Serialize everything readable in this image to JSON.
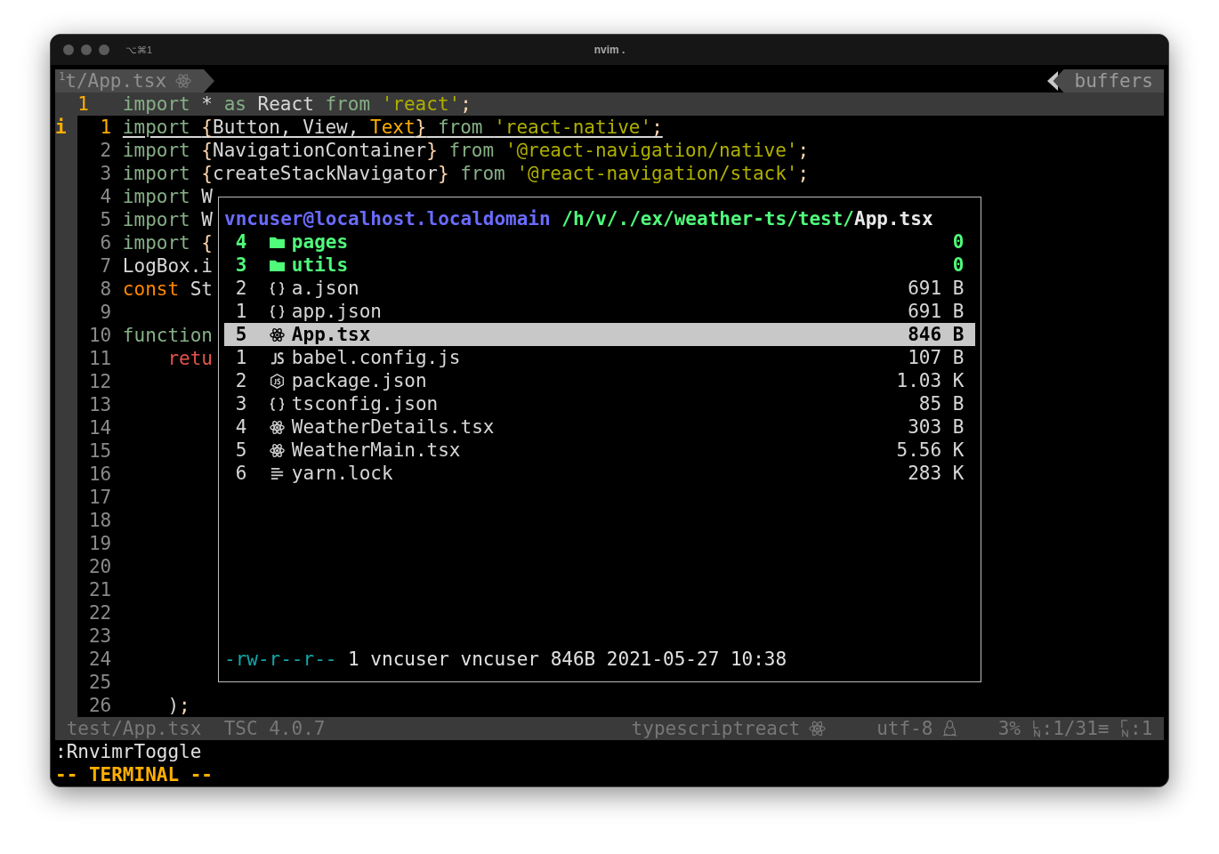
{
  "window": {
    "shortcut": "⌥⌘1",
    "title": "nvim ."
  },
  "tabline": {
    "tab": {
      "number": "1",
      "label": "t/App.tsx"
    },
    "buffers_label": "buffers"
  },
  "context_line": {
    "number": "1",
    "tokens": [
      {
        "kind": "kw",
        "text": "import"
      },
      {
        "kind": "id",
        "text": " * "
      },
      {
        "kind": "kw",
        "text": "as"
      },
      {
        "kind": "id",
        "text": " React "
      },
      {
        "kind": "kw",
        "text": "from "
      },
      {
        "kind": "str",
        "text": "'react'"
      },
      {
        "kind": "punct",
        "text": ";"
      }
    ]
  },
  "lines": [
    {
      "number": "1",
      "current": true,
      "sign": "i",
      "tokens": [
        {
          "kind": "kw",
          "text": "import "
        },
        {
          "kind": "punct",
          "text": "{"
        },
        {
          "kind": "id",
          "text": "Button, View, "
        },
        {
          "kind": "type",
          "text": "Text"
        },
        {
          "kind": "punct",
          "text": "}"
        },
        {
          "kind": "kw",
          "text": " from "
        },
        {
          "kind": "str",
          "text": "'react-native'"
        },
        {
          "kind": "punct",
          "text": ";"
        }
      ]
    },
    {
      "number": "2",
      "current": false,
      "tokens": [
        {
          "kind": "kw",
          "text": "import "
        },
        {
          "kind": "punct",
          "text": "{"
        },
        {
          "kind": "id",
          "text": "NavigationContainer"
        },
        {
          "kind": "punct",
          "text": "}"
        },
        {
          "kind": "kw",
          "text": " from "
        },
        {
          "kind": "str",
          "text": "'@react-navigation/native'"
        },
        {
          "kind": "punct",
          "text": ";"
        }
      ]
    },
    {
      "number": "3",
      "current": false,
      "tokens": [
        {
          "kind": "kw",
          "text": "import "
        },
        {
          "kind": "punct",
          "text": "{"
        },
        {
          "kind": "id",
          "text": "createStackNavigator"
        },
        {
          "kind": "punct",
          "text": "}"
        },
        {
          "kind": "kw",
          "text": " from "
        },
        {
          "kind": "str",
          "text": "'@react-navigation/stack'"
        },
        {
          "kind": "punct",
          "text": ";"
        }
      ]
    },
    {
      "number": "4",
      "current": false,
      "tokens": [
        {
          "kind": "kw",
          "text": "import"
        },
        {
          "kind": "id",
          "text": " W"
        }
      ]
    },
    {
      "number": "5",
      "current": false,
      "tokens": [
        {
          "kind": "kw",
          "text": "import"
        },
        {
          "kind": "id",
          "text": " W"
        }
      ]
    },
    {
      "number": "6",
      "current": false,
      "tokens": [
        {
          "kind": "kw",
          "text": "import "
        },
        {
          "kind": "punct",
          "text": "{"
        }
      ]
    },
    {
      "number": "7",
      "current": false,
      "tokens": [
        {
          "kind": "id",
          "text": "LogBox.i"
        }
      ]
    },
    {
      "number": "8",
      "current": false,
      "tokens": [
        {
          "kind": "decl",
          "text": "const"
        },
        {
          "kind": "id",
          "text": " St"
        }
      ]
    },
    {
      "number": "9",
      "current": false
    },
    {
      "number": "10",
      "current": false,
      "tokens": [
        {
          "kind": "kw",
          "text": "function"
        }
      ]
    },
    {
      "number": "11",
      "current": false,
      "indented": true,
      "tokens": [
        {
          "kind": "ret",
          "text": "retu"
        }
      ]
    },
    {
      "number": "12",
      "current": false
    },
    {
      "number": "13",
      "current": false
    },
    {
      "number": "14",
      "current": false
    },
    {
      "number": "15",
      "current": false
    },
    {
      "number": "16",
      "current": false
    },
    {
      "number": "17",
      "current": false
    },
    {
      "number": "18",
      "current": false
    },
    {
      "number": "19",
      "current": false
    },
    {
      "number": "20",
      "current": false
    },
    {
      "number": "21",
      "current": false
    },
    {
      "number": "22",
      "current": false
    },
    {
      "number": "23",
      "current": false
    },
    {
      "number": "24",
      "current": false
    },
    {
      "number": "25",
      "current": false
    },
    {
      "number": "26",
      "current": false,
      "indented": true,
      "tokens": [
        {
          "kind": "id",
          "text": ")"
        },
        {
          "kind": "punct",
          "text": ";"
        }
      ]
    }
  ],
  "file_manager": {
    "host": "vncuser@localhost.localdomain",
    "path": "/h/v/./ex/weather-ts/test/",
    "file": "App.tsx",
    "entries": [
      {
        "count": "4",
        "kind": "folder",
        "name": "pages",
        "size": "0",
        "selected": false
      },
      {
        "count": "3",
        "kind": "folder",
        "name": "utils",
        "size": "0",
        "selected": false
      },
      {
        "count": "2",
        "kind": "json",
        "name": "a.json",
        "size": "691 B",
        "selected": false
      },
      {
        "count": "1",
        "kind": "json",
        "name": "app.json",
        "size": "691 B",
        "selected": false
      },
      {
        "count": "5",
        "kind": "react",
        "name": "App.tsx",
        "size": "846 B",
        "selected": true
      },
      {
        "count": "1",
        "kind": "script",
        "name": "babel.config.js",
        "size": "107 B",
        "selected": false
      },
      {
        "count": "2",
        "kind": "package",
        "name": "package.json",
        "size": "1.03 K",
        "selected": false
      },
      {
        "count": "3",
        "kind": "json",
        "name": "tsconfig.json",
        "size": "85 B",
        "selected": false
      },
      {
        "count": "4",
        "kind": "react",
        "name": "WeatherDetails.tsx",
        "size": "303 B",
        "selected": false
      },
      {
        "count": "5",
        "kind": "react",
        "name": "WeatherMain.tsx",
        "size": "5.56 K",
        "selected": false
      },
      {
        "count": "6",
        "kind": "text",
        "name": "yarn.lock",
        "size": "283 K",
        "selected": false
      }
    ],
    "permissions": "-rw-r--r--",
    "info": "1 vncuser vncuser 846B 2021-05-27 10:38"
  },
  "status_line": {
    "file": "test/App.tsx",
    "tsc": "TSC 4.0.7",
    "filetype": "typescriptreact",
    "encoding": "utf-8",
    "percent": "3%",
    "line": ":1/31≡",
    "column": ":1"
  },
  "command_line": ":RnvimrToggle",
  "mode": "-- TERMINAL --"
}
